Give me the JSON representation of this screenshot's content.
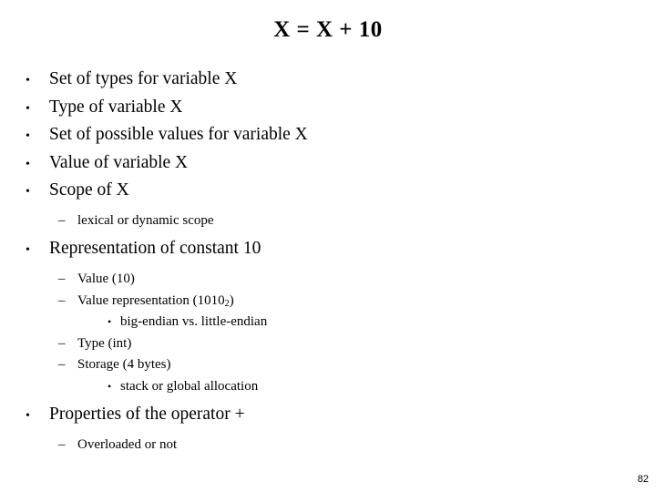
{
  "slide": {
    "title": "X = X + 10",
    "page_number": "82",
    "background_color": "#ffffff",
    "text_color": "#000000",
    "bullet_glyph_level1": "•",
    "bullet_glyph_level2": "–",
    "bullet_glyph_level3": "•",
    "outline": [
      {
        "level": 1,
        "text": "Set of types for variable X"
      },
      {
        "level": 1,
        "text": "Type of variable X"
      },
      {
        "level": 1,
        "text": "Set of possible values for variable X"
      },
      {
        "level": 1,
        "text": "Value of variable X"
      },
      {
        "level": 1,
        "text": "Scope of X"
      },
      {
        "level": 2,
        "text": "lexical or dynamic scope"
      },
      {
        "level": 1,
        "text": "Representation of constant 10"
      },
      {
        "level": 2,
        "text": "Value (10)"
      },
      {
        "level": 2,
        "text": "Value representation (1010",
        "subscript": "2",
        "text_after": ")"
      },
      {
        "level": 3,
        "text": "big-endian vs. little-endian"
      },
      {
        "level": 2,
        "text": "Type (int)"
      },
      {
        "level": 2,
        "text": "Storage (4 bytes)"
      },
      {
        "level": 3,
        "text": "stack or global allocation"
      },
      {
        "level": 1,
        "text": "Properties of the operator +"
      },
      {
        "level": 2,
        "text": "Overloaded or not"
      }
    ]
  }
}
